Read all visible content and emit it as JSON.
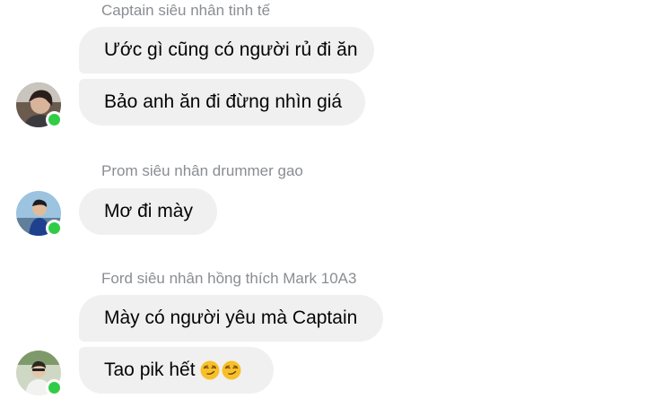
{
  "groups": [
    {
      "sender": "Captain siêu nhân tinh tế",
      "messages": [
        "Ước gì cũng có người rủ đi ăn",
        "Bảo anh ăn đi đừng nhìn giá"
      ],
      "avatar_icon": "user-avatar-photo"
    },
    {
      "sender": "Prom siêu nhân drummer gao",
      "messages": [
        "Mơ đi mày"
      ],
      "avatar_icon": "user-avatar-photo"
    },
    {
      "sender": "Ford siêu nhân hồng thích Mark 10A3",
      "messages": [
        "Mày có người yêu mà Captain",
        "Tao pik hết"
      ],
      "emojis": [
        "smirking-face",
        "smirking-face"
      ],
      "avatar_icon": "user-avatar-photo"
    }
  ],
  "colors": {
    "bubble": "#f0f0f0",
    "sender_text": "#8a8d91",
    "message_text": "#050505",
    "online": "#31cc46"
  }
}
